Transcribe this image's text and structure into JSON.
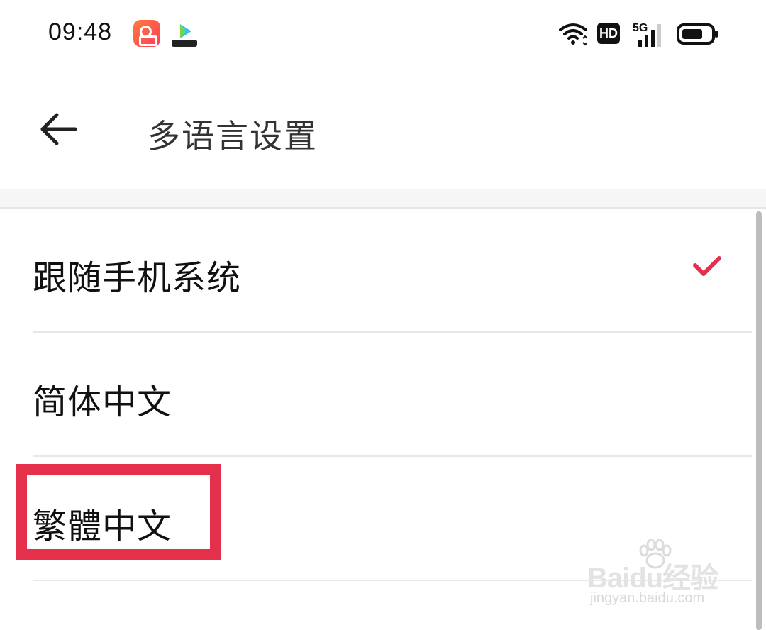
{
  "status_bar": {
    "time": "09:48",
    "network": "5G",
    "hd_label": "HD",
    "icons": [
      "kuaishou-app-icon",
      "video-app-icon",
      "wifi-icon",
      "hd-icon",
      "signal-icon",
      "battery-icon"
    ]
  },
  "header": {
    "title": "多语言设置",
    "back_icon": "arrow-left-icon"
  },
  "languages": [
    {
      "label": "跟随手机系统",
      "selected": true
    },
    {
      "label": "简体中文",
      "selected": false
    },
    {
      "label": "繁體中文",
      "selected": false
    }
  ],
  "colors": {
    "accent": "#e4304a",
    "highlight": "#e4304a",
    "background": "#ffffff"
  },
  "watermark": {
    "logo": "Baidu经验",
    "url": "jingyan.baidu.com"
  }
}
